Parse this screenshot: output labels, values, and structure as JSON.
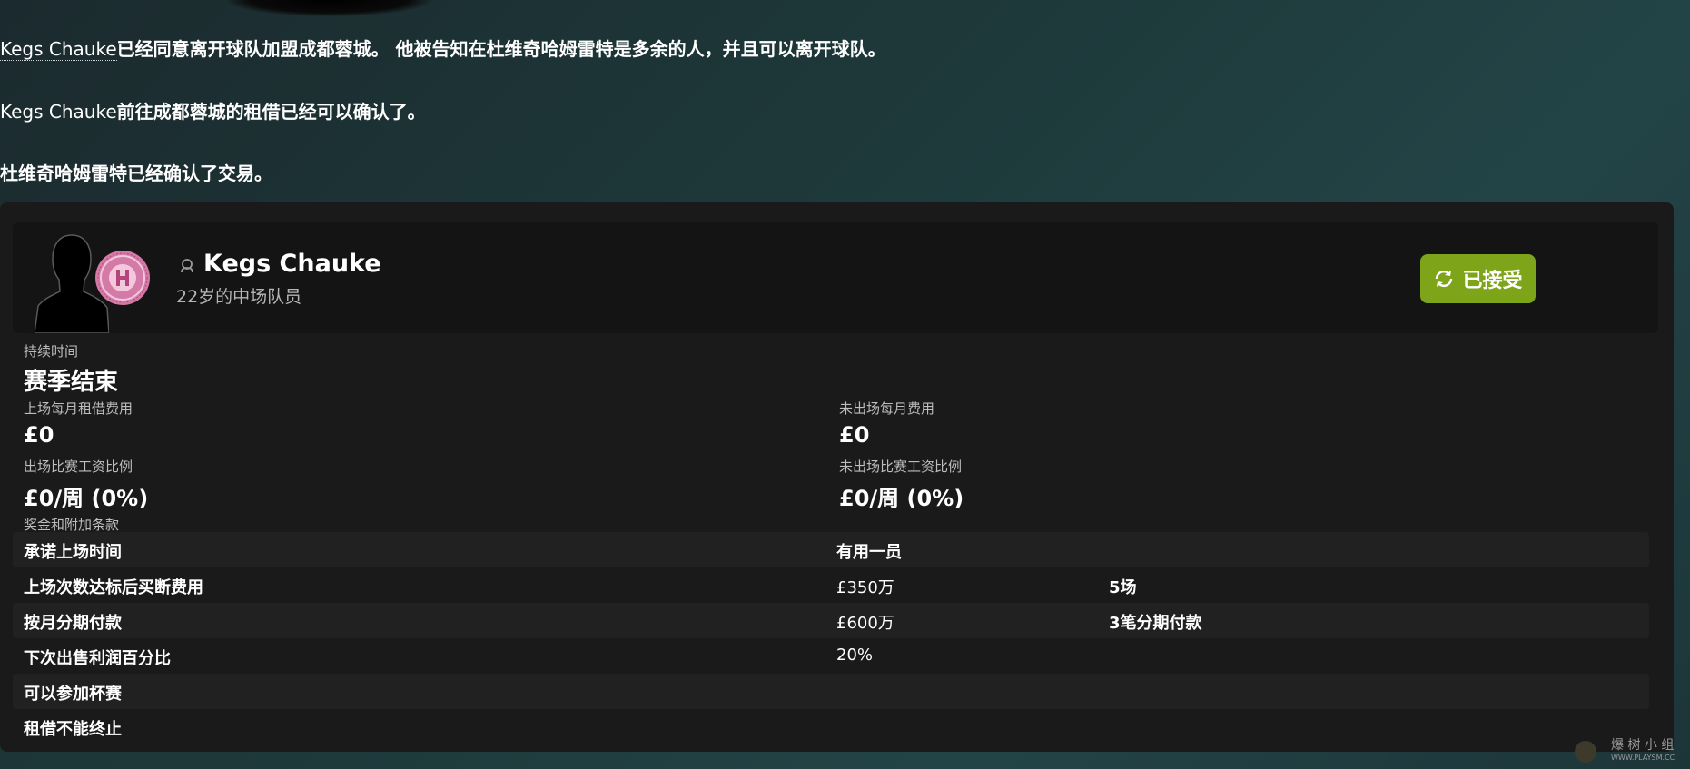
{
  "messages": {
    "msg1": {
      "player": "Kegs Chauke",
      "text": "已经同意离开球队加盟成都蓉城。 他被告知在杜维奇哈姆雷特是多余的人，并且可以离开球队。"
    },
    "msg2": {
      "player": "Kegs Chauke",
      "text": "前往成都蓉城的租借已经可以确认了。"
    },
    "msg3": {
      "text": "杜维奇哈姆雷特已经确认了交易。"
    }
  },
  "player": {
    "name": "Kegs Chauke",
    "description": "22岁的中场队员",
    "status_label": "已接受"
  },
  "terms": {
    "duration_label": "持续时间",
    "duration_value": "赛季结束",
    "fee_played_label": "上场每月租借费用",
    "fee_played_value": "£0",
    "fee_unplayed_label": "未出场每月费用",
    "fee_unplayed_value": "£0",
    "wage_played_label": "出场比赛工资比例",
    "wage_played_value": "£0/周 (0%)",
    "wage_unplayed_label": "未出场比赛工资比例",
    "wage_unplayed_value": "£0/周 (0%)",
    "bonus_label": "奖金和附加条款"
  },
  "clauses": [
    {
      "name": "承诺上场时间",
      "value": "有用一员",
      "extra": ""
    },
    {
      "name": "上场次数达标后买断费用",
      "value": "£350万",
      "extra": "5场"
    },
    {
      "name": "按月分期付款",
      "value": "£600万",
      "extra": "3笔分期付款"
    },
    {
      "name": "下次出售利润百分比",
      "value": "20%",
      "extra": ""
    },
    {
      "name": "可以参加杯赛",
      "value": "",
      "extra": ""
    },
    {
      "name": "租借不能终止",
      "value": "",
      "extra": ""
    }
  ],
  "watermark": {
    "text": "爆 树 小 组",
    "sub": "WWW.PLAYSM.CC"
  },
  "colors": {
    "accent_green": "#7ea51a",
    "panel": "#1a1a1a",
    "card": "#141414",
    "badge": "#d47aa7"
  },
  "icons": {
    "status": "refresh-icon",
    "player_type": "person-icon"
  }
}
